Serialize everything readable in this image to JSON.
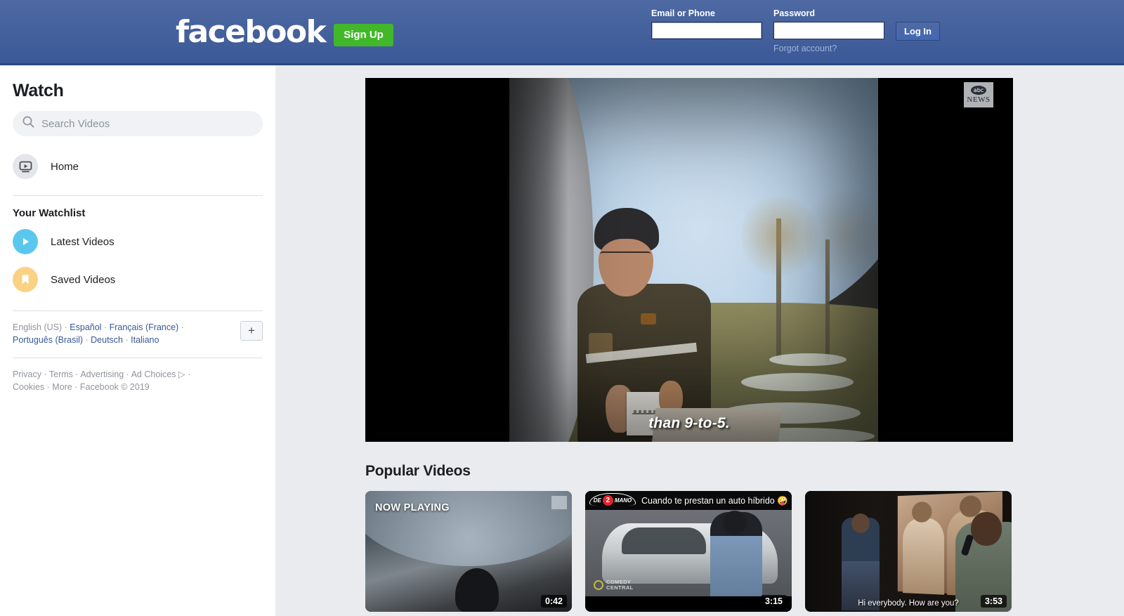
{
  "header": {
    "logo_text": "facebook",
    "signup_label": "Sign Up",
    "email_label": "Email or Phone",
    "email_value": "",
    "password_label": "Password",
    "password_value": "",
    "login_label": "Log In",
    "forgot_label": "Forgot account?",
    "brand_color": "#3b5998",
    "signup_color": "#42b72a"
  },
  "sidebar": {
    "title": "Watch",
    "search_placeholder": "Search Videos",
    "home": {
      "label": "Home",
      "icon": "video-play-screen-icon"
    },
    "watchlist_heading": "Your Watchlist",
    "watchlist": [
      {
        "label": "Latest Videos",
        "icon": "play-circle-icon",
        "color": "#5ac8ee"
      },
      {
        "label": "Saved Videos",
        "icon": "bookmark-icon",
        "color": "#fbd283"
      }
    ],
    "languages": {
      "current": "English (US)",
      "links": [
        "Español",
        "Français (France)",
        "Português (Brasil)",
        "Deutsch",
        "Italiano"
      ],
      "add_label": "+"
    },
    "legal": {
      "links": [
        "Privacy",
        "Terms",
        "Advertising",
        "Ad Choices",
        "Cookies",
        "More"
      ],
      "copyright": "Facebook © 2019",
      "ad_choices_icon": "ad-choices-icon"
    }
  },
  "player": {
    "watermark_badge": "abc",
    "watermark_text": "NEWS",
    "caption": "than 9-to-5."
  },
  "popular": {
    "heading": "Popular Videos",
    "videos": [
      {
        "now_playing_label": "NOW PLAYING",
        "duration": "0:42",
        "watermark": "abc NEWS"
      },
      {
        "channel_logo_left": "DE",
        "channel_logo_number": "2",
        "channel_logo_right": "MANO",
        "title": "Cuando te prestan un auto híbrido 🤪",
        "network_line1": "COMEDY",
        "network_line2": "CENTRAL",
        "duration": "3:15"
      },
      {
        "caption": "Hi everybody. How are you?",
        "duration": "3:53"
      }
    ]
  }
}
